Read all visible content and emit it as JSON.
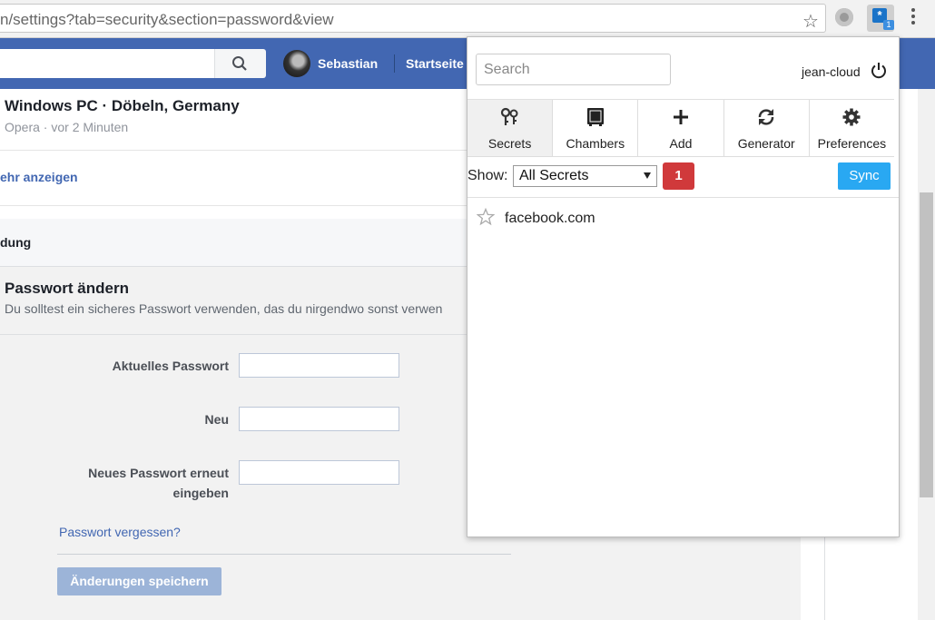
{
  "browser": {
    "url": "n/settings?tab=security&section=password&view",
    "extension_badge": "1",
    "icons": {
      "bookmark": "star-icon",
      "extension": "gear-icon",
      "menu": "vertical-dots-icon"
    }
  },
  "facebook": {
    "search_placeholder": "",
    "user_name": "Sebastian",
    "home_label": "Startseite",
    "colors": {
      "bar": "#4267b2",
      "link": "#4267b2"
    }
  },
  "content": {
    "device_title": "Windows PC · Döbeln, Germany",
    "device_sub": "Opera · vor 2 Minuten",
    "more_link": "ehr anzeigen",
    "section_title": "dung",
    "password": {
      "title": "Passwort ändern",
      "description": "Du solltest ein sicheres Passwort verwenden, das du nirgendwo sonst verwen",
      "current_label": "Aktuelles Passwort",
      "new_label": "Neu",
      "repeat_label": "Neues Passwort erneut eingeben",
      "forgot_link": "Passwort vergessen?",
      "save_button": "Änderungen speichern"
    }
  },
  "popup": {
    "search_placeholder": "Search",
    "user": "jean-cloud",
    "tabs": [
      {
        "label": "Secrets",
        "icon": "keys-icon",
        "active": true
      },
      {
        "label": "Chambers",
        "icon": "safe-icon",
        "active": false
      },
      {
        "label": "Add",
        "icon": "plus-icon",
        "active": false
      },
      {
        "label": "Generator",
        "icon": "refresh-icon",
        "active": false
      },
      {
        "label": "Preferences",
        "icon": "gear-icon",
        "active": false
      }
    ],
    "show_label": "Show:",
    "show_selected": "All Secrets",
    "count": "1",
    "sync_label": "Sync",
    "items": [
      {
        "name": "facebook.com",
        "starred": false
      }
    ],
    "colors": {
      "badge": "#d0393b",
      "sync": "#29a8f2"
    }
  }
}
